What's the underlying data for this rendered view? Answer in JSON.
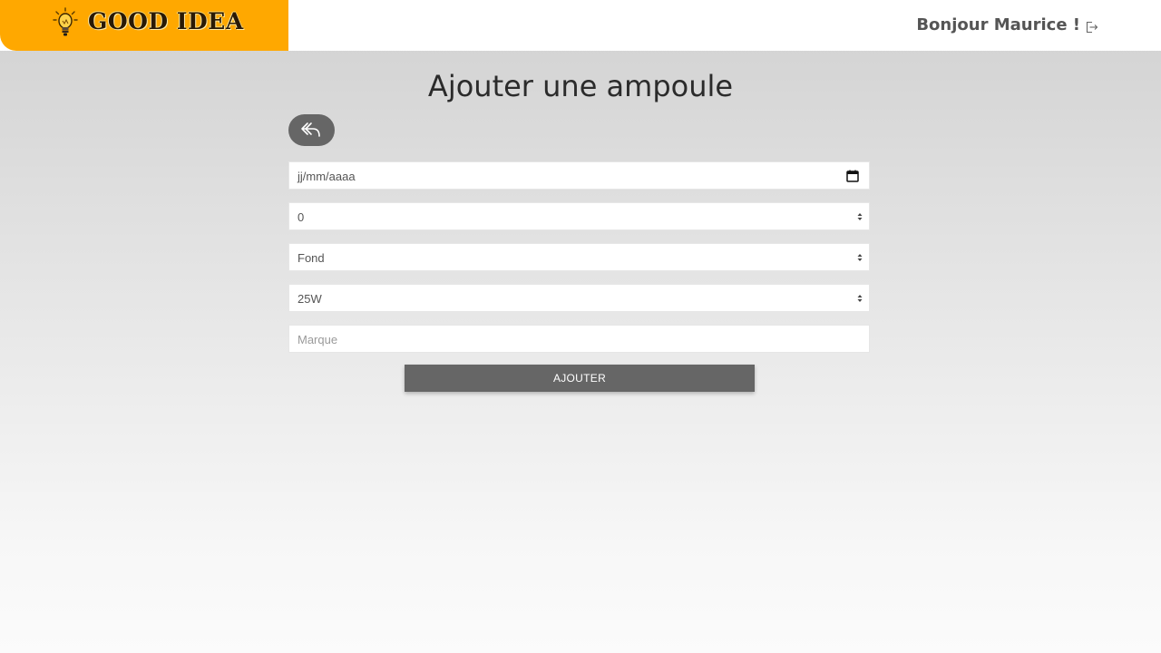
{
  "header": {
    "logo_text": "GOOD IDEA",
    "greeting": "Bonjour Maurice !",
    "brand_color": "#ffa800",
    "logout_icon": "logout-icon"
  },
  "main": {
    "title": "Ajouter une ampoule",
    "back_icon": "reply-arrow-icon",
    "fields": {
      "date": {
        "placeholder": "jj/mm/aaaa",
        "icon": "calendar-icon"
      },
      "quantity": {
        "value": "0",
        "icon": "spinner-icon"
      },
      "position": {
        "value": "Fond",
        "icon": "spinner-icon"
      },
      "power": {
        "value": "25W",
        "icon": "spinner-icon"
      },
      "brand": {
        "placeholder": "Marque"
      }
    },
    "submit_label": "AJOUTER",
    "button_color": "#666666"
  }
}
